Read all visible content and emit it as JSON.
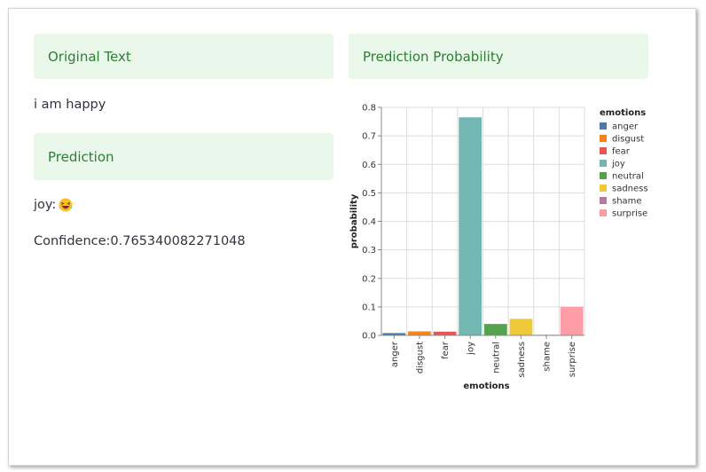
{
  "original_text": {
    "header": "Original Text",
    "value": "i am happy"
  },
  "prediction": {
    "header": "Prediction",
    "label": "joy:",
    "emoji_icon": "laughing-face-icon",
    "confidence": "Confidence:0.765340082271048"
  },
  "probability_panel": {
    "header": "Prediction Probability"
  },
  "chart_data": {
    "type": "bar",
    "categories": [
      "anger",
      "disgust",
      "fear",
      "joy",
      "neutral",
      "sadness",
      "shame",
      "surprise"
    ],
    "values": [
      0.008,
      0.014,
      0.013,
      0.765,
      0.04,
      0.058,
      0.002,
      0.1
    ],
    "colors": [
      "#4c78a8",
      "#f58518",
      "#e45756",
      "#72b7b2",
      "#54a24b",
      "#eeca3b",
      "#b279a2",
      "#ff9da6"
    ],
    "xlabel": "emotions",
    "ylabel": "probability",
    "ylim": [
      0,
      0.8
    ],
    "yticks": [
      "0.0",
      "0.1",
      "0.2",
      "0.3",
      "0.4",
      "0.5",
      "0.6",
      "0.7",
      "0.8"
    ],
    "grid": true,
    "legend": {
      "title": "emotions",
      "placement": "right",
      "entries": [
        "anger",
        "disgust",
        "fear",
        "joy",
        "neutral",
        "sadness",
        "shame",
        "surprise"
      ]
    }
  }
}
